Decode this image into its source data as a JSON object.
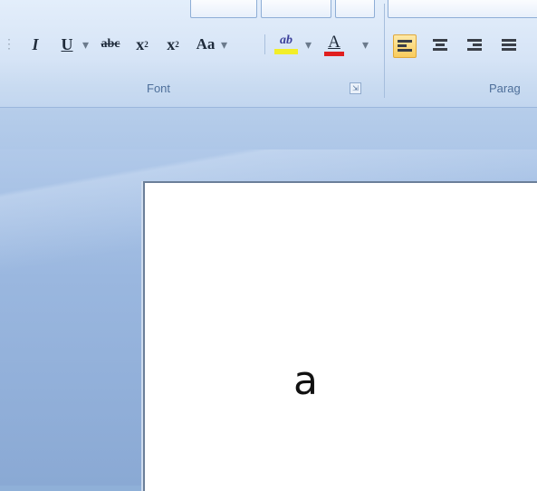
{
  "ribbon": {
    "font_group": {
      "label": "Font",
      "buttons": {
        "italic": "I",
        "underline": "U",
        "strikethrough": "abc",
        "subscript": "x",
        "subscript_mark": "2",
        "superscript": "x",
        "superscript_mark": "2",
        "change_case": "Aa",
        "highlight": "ab",
        "font_color": "A"
      },
      "launcher_glyph": "⇲"
    },
    "paragraph_group": {
      "label": "Parag"
    }
  },
  "colors": {
    "highlight": "#f2ee2a",
    "font_color": "#e01f1f",
    "active_button": "#f9cc5c"
  },
  "document": {
    "content": "a"
  }
}
